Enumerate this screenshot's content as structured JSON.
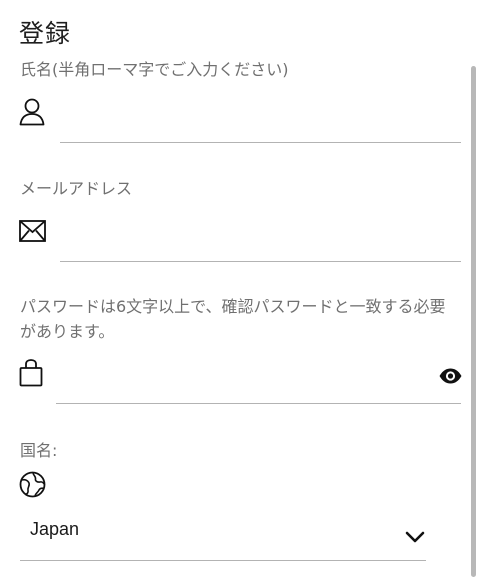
{
  "page": {
    "title": "登録"
  },
  "form": {
    "name_label": "氏名(半角ローマ字でご入力ください)",
    "name_value": "",
    "email_label": "メールアドレス",
    "email_value": "",
    "password_label": "パスワードは6文字以上で、確認パスワードと一致する必要があります。",
    "password_value": "",
    "country_label": "国名:",
    "country_value": "Japan"
  },
  "icons": {
    "name": "person-icon",
    "email": "envelope-icon",
    "password": "lock-icon",
    "visibility": "eye-icon",
    "country": "globe-icon",
    "dropdown": "chevron-down-icon"
  },
  "colors": {
    "label": "#707070",
    "underline": "#b3b3b3",
    "text": "#1a1a1a"
  }
}
